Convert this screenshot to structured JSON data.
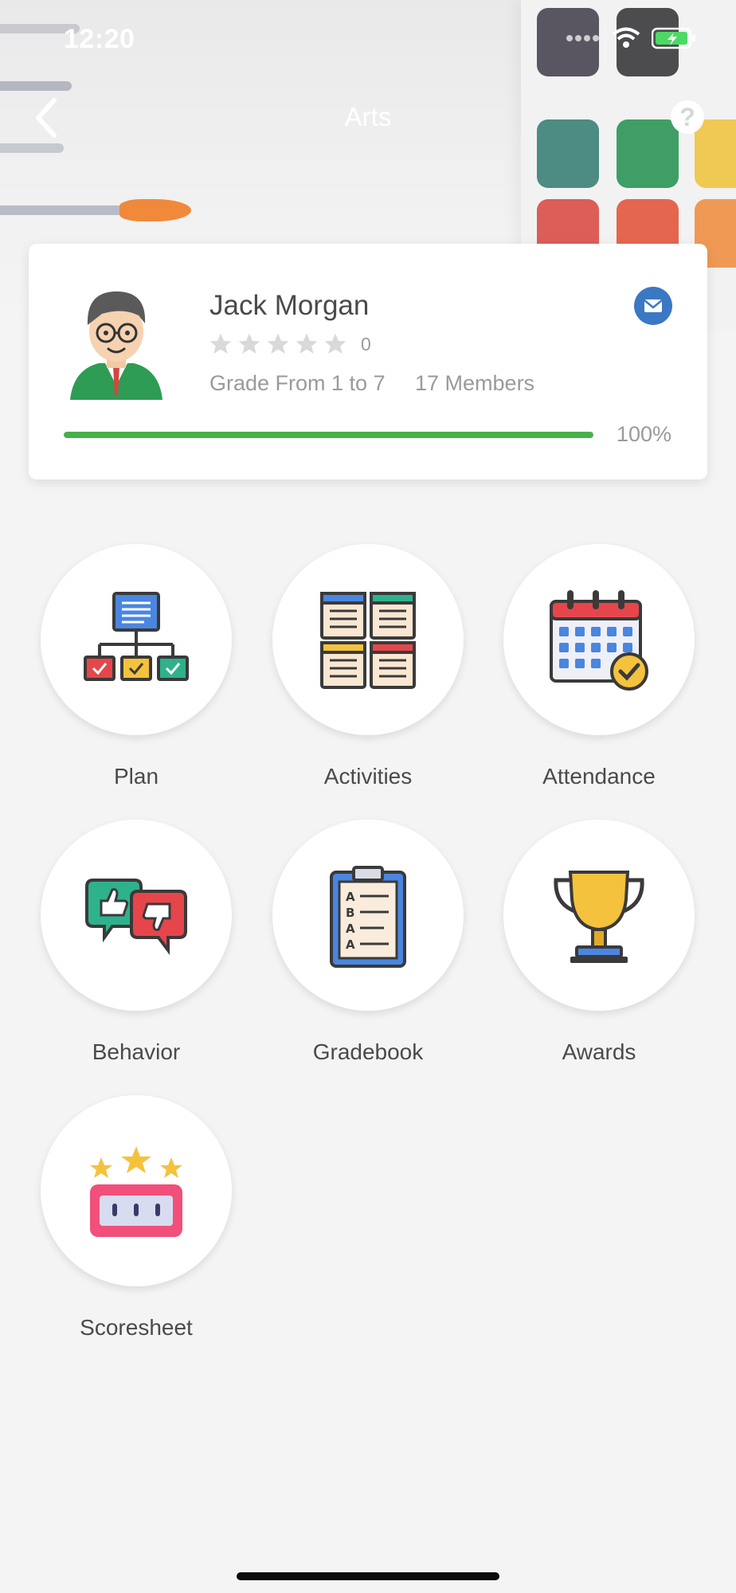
{
  "status_bar": {
    "time": "12:20"
  },
  "header": {
    "title": "Arts",
    "back_icon": "chevron-left-icon",
    "help_icon": "question-icon",
    "help_glyph": "?"
  },
  "profile": {
    "name": "Jack Morgan",
    "rating": 0,
    "rating_label": "0",
    "max_stars": 5,
    "grade_range": "Grade From 1 to 7",
    "members": "17 Members",
    "progress": 1.0,
    "progress_label": "100%",
    "mail_icon": "mail-icon"
  },
  "menu": [
    {
      "label": "Plan",
      "icon": "plan-hierarchy-icon"
    },
    {
      "label": "Activities",
      "icon": "activities-notes-icon"
    },
    {
      "label": "Attendance",
      "icon": "attendance-calendar-icon"
    },
    {
      "label": "Behavior",
      "icon": "behavior-thumbs-icon"
    },
    {
      "label": "Gradebook",
      "icon": "gradebook-clipboard-icon"
    },
    {
      "label": "Awards",
      "icon": "awards-trophy-icon"
    },
    {
      "label": "Scoresheet",
      "icon": "scoresheet-stars-icon"
    }
  ],
  "colors": {
    "accent": "#3a78c4",
    "progress": "#48b04b",
    "background": "#f4f4f4"
  }
}
